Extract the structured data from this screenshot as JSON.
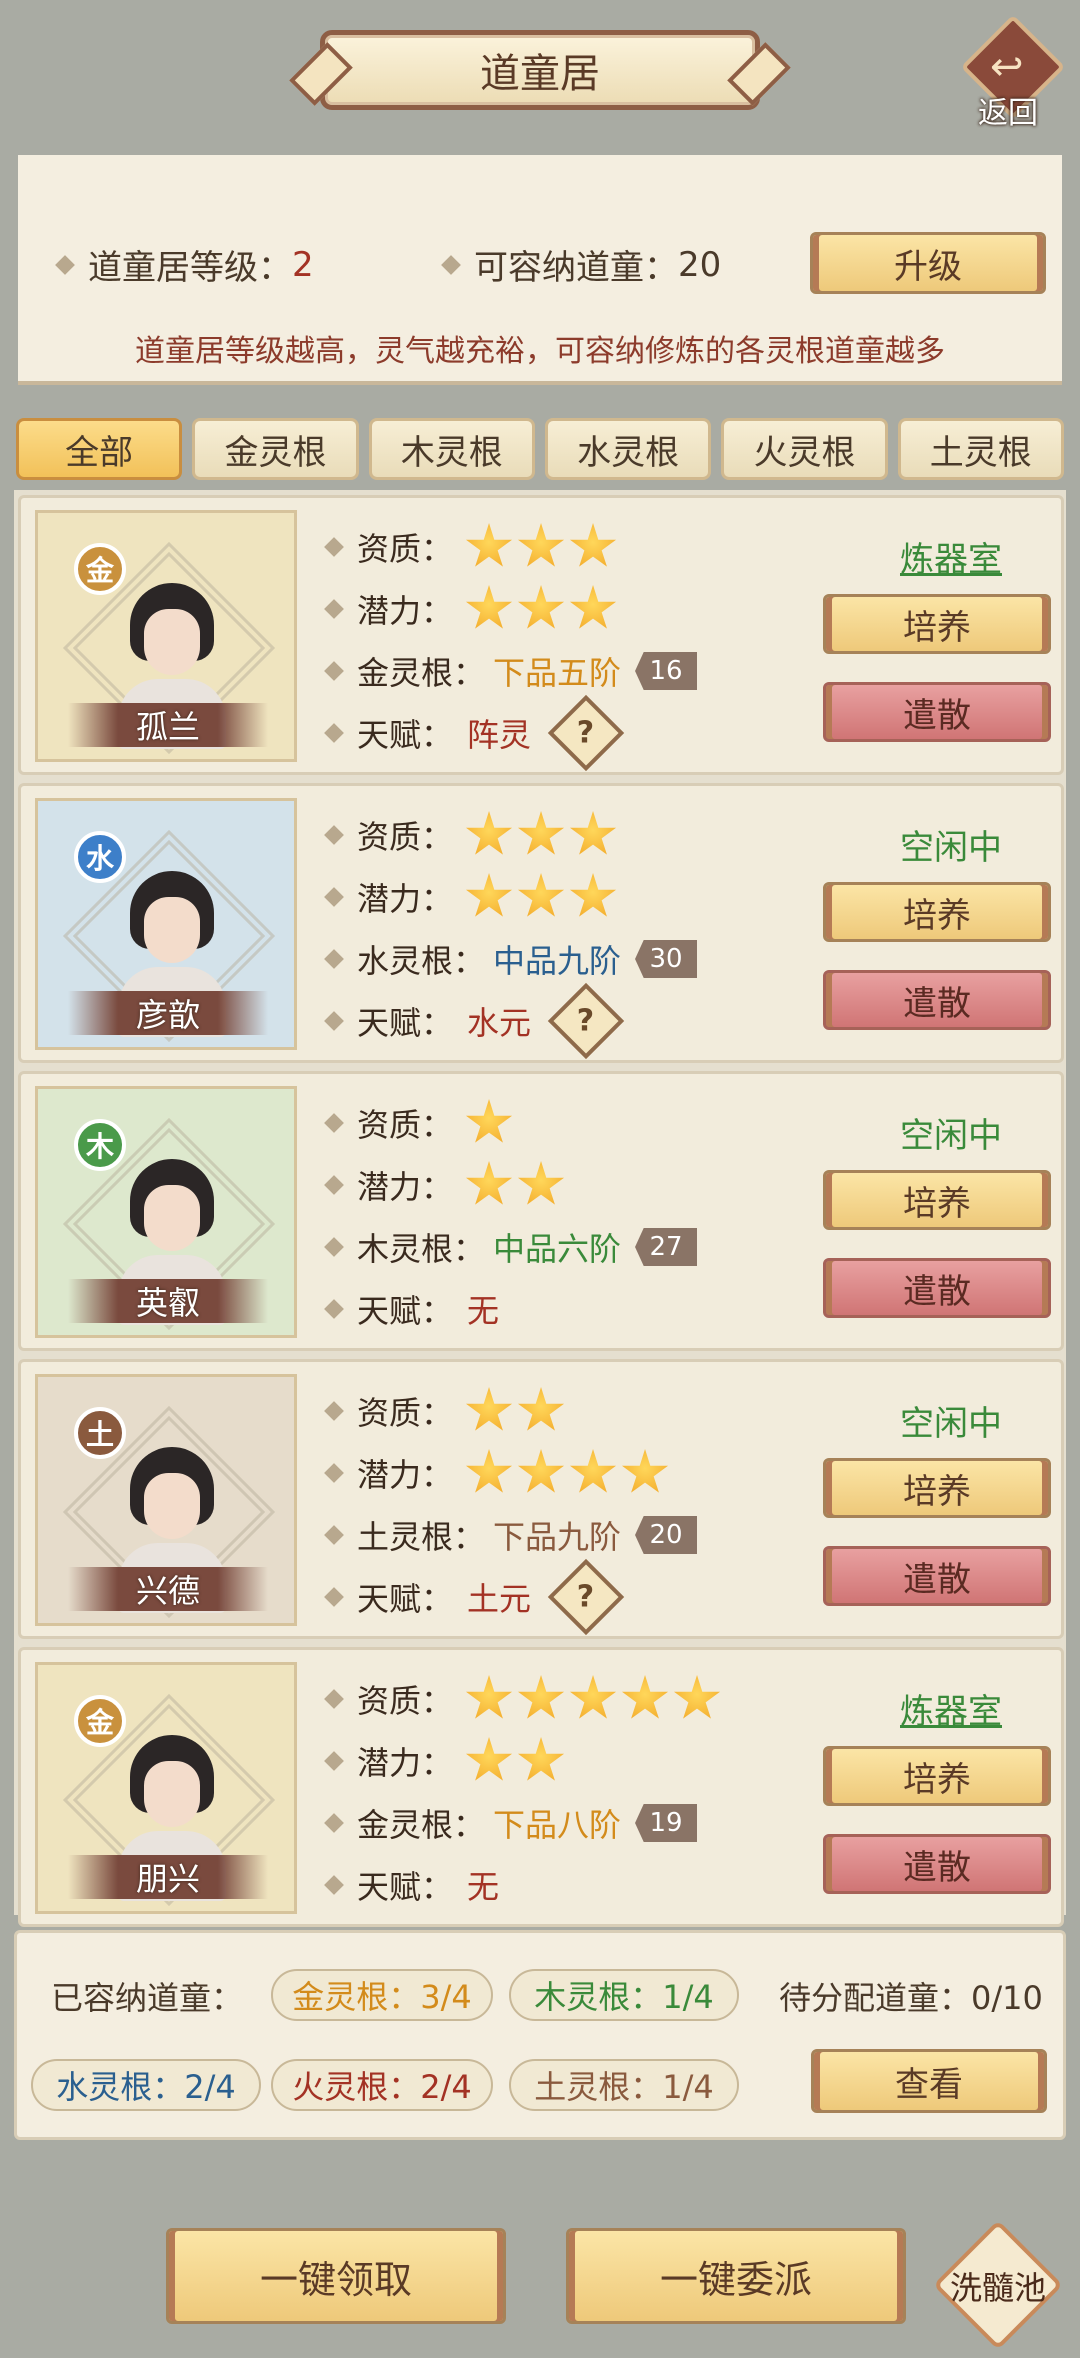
{
  "header": {
    "title": "道童居",
    "back_label": "返回"
  },
  "info": {
    "level_label": "道童居等级：",
    "level_value": "2",
    "capacity_label": "可容纳道童：",
    "capacity_value": "20",
    "upgrade_label": "升级",
    "hint": "道童居等级越高，灵气越充裕，可容纳修炼的各灵根道童越多"
  },
  "tabs": [
    "全部",
    "金灵根",
    "木灵根",
    "水灵根",
    "火灵根",
    "土灵根"
  ],
  "labels": {
    "aptitude": "资质：",
    "potential": "潜力：",
    "talent": "天赋：",
    "train": "培养",
    "dismiss": "遣散"
  },
  "students": [
    {
      "name": "孤兰",
      "element": "金",
      "element_color": "#c9913d",
      "bg": "#efe4bf",
      "aptitude": 3,
      "potential": 3,
      "root_label": "金灵根：",
      "grade": "下品五阶",
      "grade_color": "#d38b1b",
      "level": "16",
      "talent": "阵灵",
      "has_talent_icon": true,
      "status": "炼器室",
      "status_type": "link"
    },
    {
      "name": "彦歆",
      "element": "水",
      "element_color": "#3d7fc9",
      "bg": "#d3e2ea",
      "aptitude": 3,
      "potential": 3,
      "root_label": "水灵根：",
      "grade": "中品九阶",
      "grade_color": "#2a5f8f",
      "level": "30",
      "talent": "水元",
      "has_talent_icon": true,
      "status": "空闲中",
      "status_type": "idle"
    },
    {
      "name": "英叡",
      "element": "木",
      "element_color": "#4a9a4a",
      "bg": "#dde8cd",
      "aptitude": 1,
      "potential": 2,
      "root_label": "木灵根：",
      "grade": "中品六阶",
      "grade_color": "#3a8a3a",
      "level": "27",
      "talent": "无",
      "has_talent_icon": false,
      "status": "空闲中",
      "status_type": "idle"
    },
    {
      "name": "兴德",
      "element": "土",
      "element_color": "#8a5a3e",
      "bg": "#e6dccb",
      "aptitude": 2,
      "potential": 4,
      "root_label": "土灵根：",
      "grade": "下品九阶",
      "grade_color": "#8a5a3e",
      "level": "20",
      "talent": "土元",
      "has_talent_icon": true,
      "status": "空闲中",
      "status_type": "idle"
    },
    {
      "name": "朋兴",
      "element": "金",
      "element_color": "#c9913d",
      "bg": "#efe4bf",
      "aptitude": 5,
      "potential": 2,
      "root_label": "金灵根：",
      "grade": "下品八阶",
      "grade_color": "#d38b1b",
      "level": "19",
      "talent": "无",
      "has_talent_icon": false,
      "status": "炼器室",
      "status_type": "link"
    }
  ],
  "summary": {
    "housed_label": "已容纳道童：",
    "pending_label": "待分配道童：0/10",
    "counts": [
      {
        "text": "金灵根：3/4",
        "color": "#d38b1b"
      },
      {
        "text": "木灵根：1/4",
        "color": "#3a8a3a"
      },
      {
        "text": "水灵根：2/4",
        "color": "#2a5f8f"
      },
      {
        "text": "火灵根：2/4",
        "color": "#a33224"
      },
      {
        "text": "土灵根：1/4",
        "color": "#8a5a3e"
      }
    ],
    "view_label": "查看"
  },
  "actions": {
    "claim_all": "一键领取",
    "assign_all": "一键委派",
    "pool": "洗髓池"
  }
}
